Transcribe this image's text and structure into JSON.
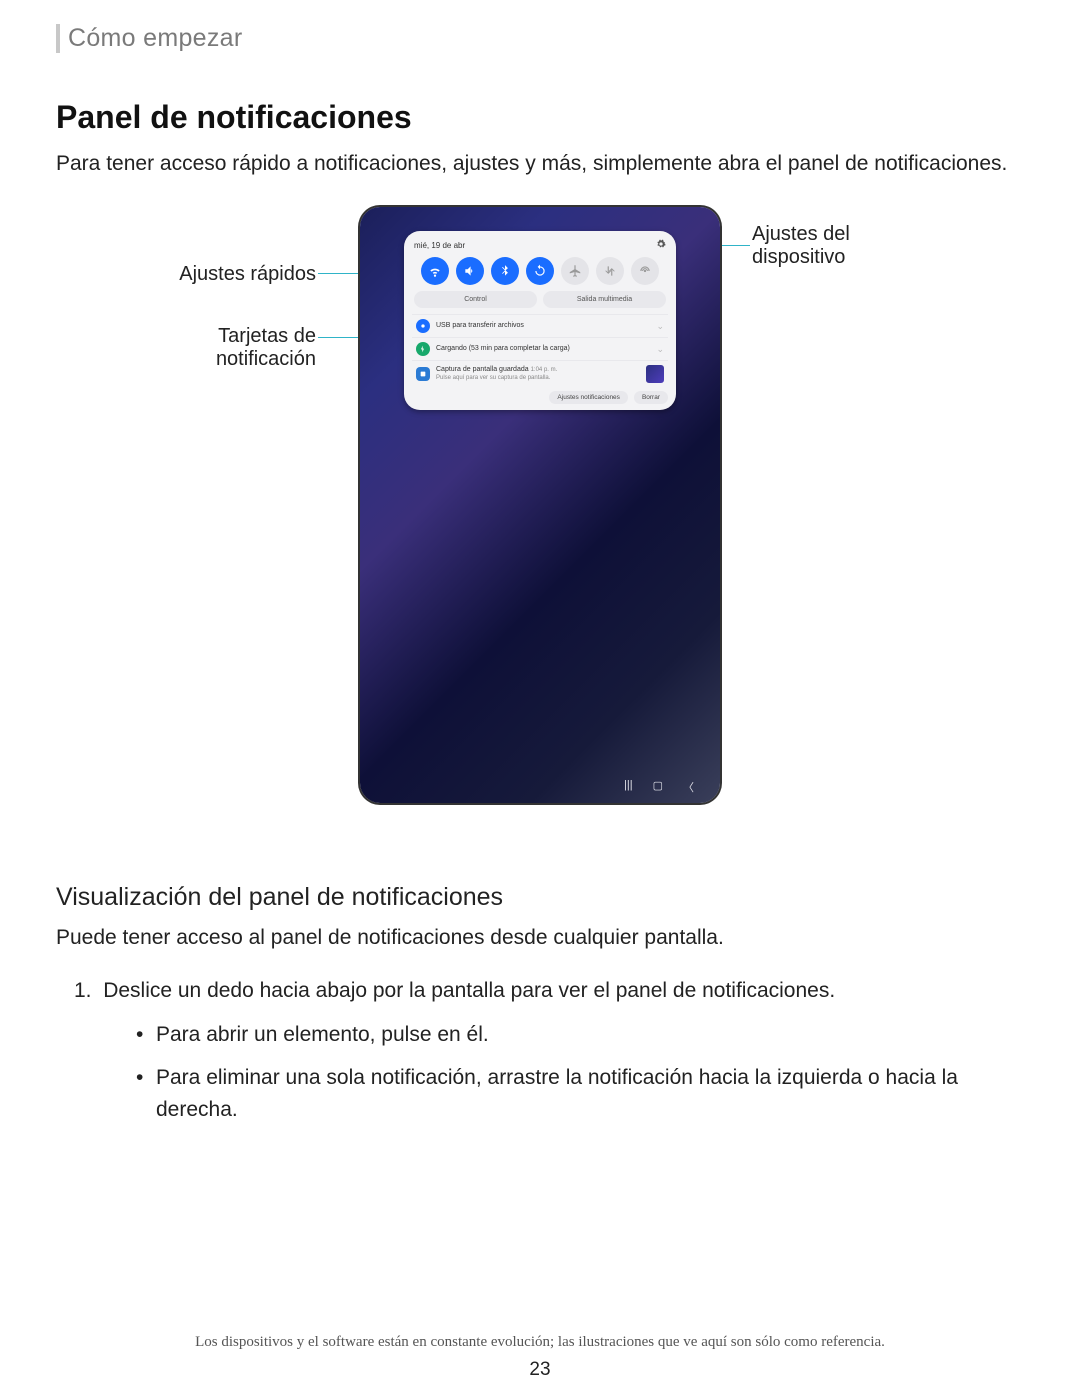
{
  "breadcrumb": "Cómo empezar",
  "h1": "Panel de notificaciones",
  "intro": "Para tener acceso rápido a notificaciones, ajustes y más, simplemente abra el panel de notificaciones.",
  "callouts": {
    "quick_settings": "Ajustes rápidos",
    "notif_cards_l1": "Tarjetas de",
    "notif_cards_l2": "notificación",
    "device_settings_l1": "Ajustes del",
    "device_settings_l2": "dispositivo"
  },
  "panel": {
    "date": "mié, 19 de abr",
    "segments": {
      "control": "Control",
      "media": "Salida multimedia"
    },
    "notifs": {
      "usb": "USB para transferir archivos",
      "charging": "Cargando (53 min para completar la carga)",
      "screenshot_title": "Captura de pantalla guardada",
      "screenshot_time": "1:04 p. m.",
      "screenshot_sub": "Pulse aquí para ver su captura de pantalla."
    },
    "actions": {
      "settings": "Ajustes notificaciones",
      "clear": "Borrar"
    }
  },
  "h2": "Visualización del panel de notificaciones",
  "body2": "Puede tener acceso al panel de notificaciones desde cualquier pantalla.",
  "step1_num": "1.",
  "step1": "Deslice un dedo hacia abajo por la pantalla para ver el panel de notificaciones.",
  "bullet1": "Para abrir un elemento, pulse en él.",
  "bullet2": "Para eliminar una sola notificación, arrastre la notificación hacia la izquierda o hacia la derecha.",
  "footnote": "Los dispositivos y el software están en constante evolución; las ilustraciones que ve aquí son sólo como referencia.",
  "page_number": "23"
}
